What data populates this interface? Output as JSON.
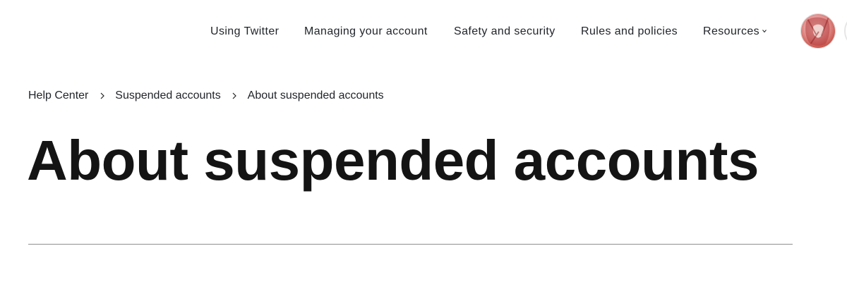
{
  "nav": {
    "items": [
      {
        "label": "Using Twitter"
      },
      {
        "label": "Managing your account"
      },
      {
        "label": "Safety and security"
      },
      {
        "label": "Rules and policies"
      },
      {
        "label": "Resources"
      }
    ],
    "resources_icon": "chevron-down-icon"
  },
  "user": {
    "avatar_icon": "avatar",
    "avatar_colors": [
      "#c0392b",
      "#e8a1a1",
      "#f7d7d0"
    ]
  },
  "breadcrumb": {
    "items": [
      {
        "label": "Help Center"
      },
      {
        "label": "Suspended accounts"
      },
      {
        "label": "About suspended accounts"
      }
    ],
    "separator_icon": "chevron-right-icon"
  },
  "article": {
    "title": "About suspended accounts"
  },
  "colors": {
    "text": "#141414",
    "divider": "#8e8e8e",
    "background": "#ffffff"
  }
}
